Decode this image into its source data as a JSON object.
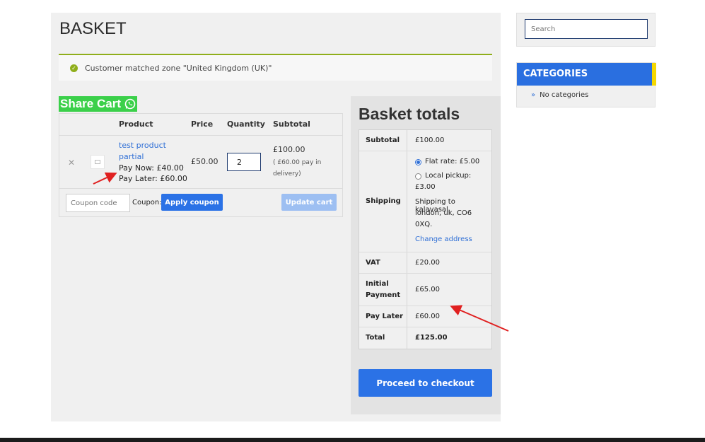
{
  "page": {
    "title": "BASKET"
  },
  "notice": {
    "text": "Customer matched zone \"United Kingdom (UK)\""
  },
  "share_cart": {
    "label": "Share Cart"
  },
  "cart": {
    "headers": {
      "product": "Product",
      "price": "Price",
      "quantity": "Quantity",
      "subtotal": "Subtotal"
    },
    "item": {
      "name": "test product partial",
      "pay_now": "Pay Now: £40.00",
      "pay_later": "Pay Later: £60.00",
      "price": "£50.00",
      "quantity": "2",
      "subtotal": "£100.00",
      "subtotal_note": "( £60.00 pay in delivery)"
    },
    "coupon_placeholder": "Coupon code",
    "coupon_label": "Coupon:",
    "apply_coupon": "Apply coupon",
    "update_cart": "Update cart"
  },
  "totals": {
    "title": "Basket totals",
    "subtotal_label": "Subtotal",
    "subtotal_value": "£100.00",
    "shipping_label": "Shipping",
    "flat_rate": "Flat rate: £5.00",
    "local_pickup_line1": "Local pickup:",
    "local_pickup_line2": "£3.00",
    "shipping_to_1": "Shipping to kalavasal,",
    "shipping_to_2": "london, uk, CO6",
    "shipping_to_3": "0XQ.",
    "change_address": "Change address",
    "vat_label": "VAT",
    "vat_value": "£20.00",
    "initial_label_1": "Initial",
    "initial_label_2": "Payment",
    "initial_value": "£65.00",
    "pay_later_label": "Pay Later",
    "pay_later_value": "£60.00",
    "total_label": "Total",
    "total_value": "£125.00",
    "checkout": "Proceed to checkout"
  },
  "sidebar": {
    "search_placeholder": "Search",
    "categories_title": "CATEGORIES",
    "no_categories": "No categories"
  },
  "colors": {
    "accent": "#2b72e6",
    "success": "#8fae1b",
    "share_green": "#3bd04a",
    "annotation_red": "#e02020",
    "category_bar": "#f5d800"
  }
}
